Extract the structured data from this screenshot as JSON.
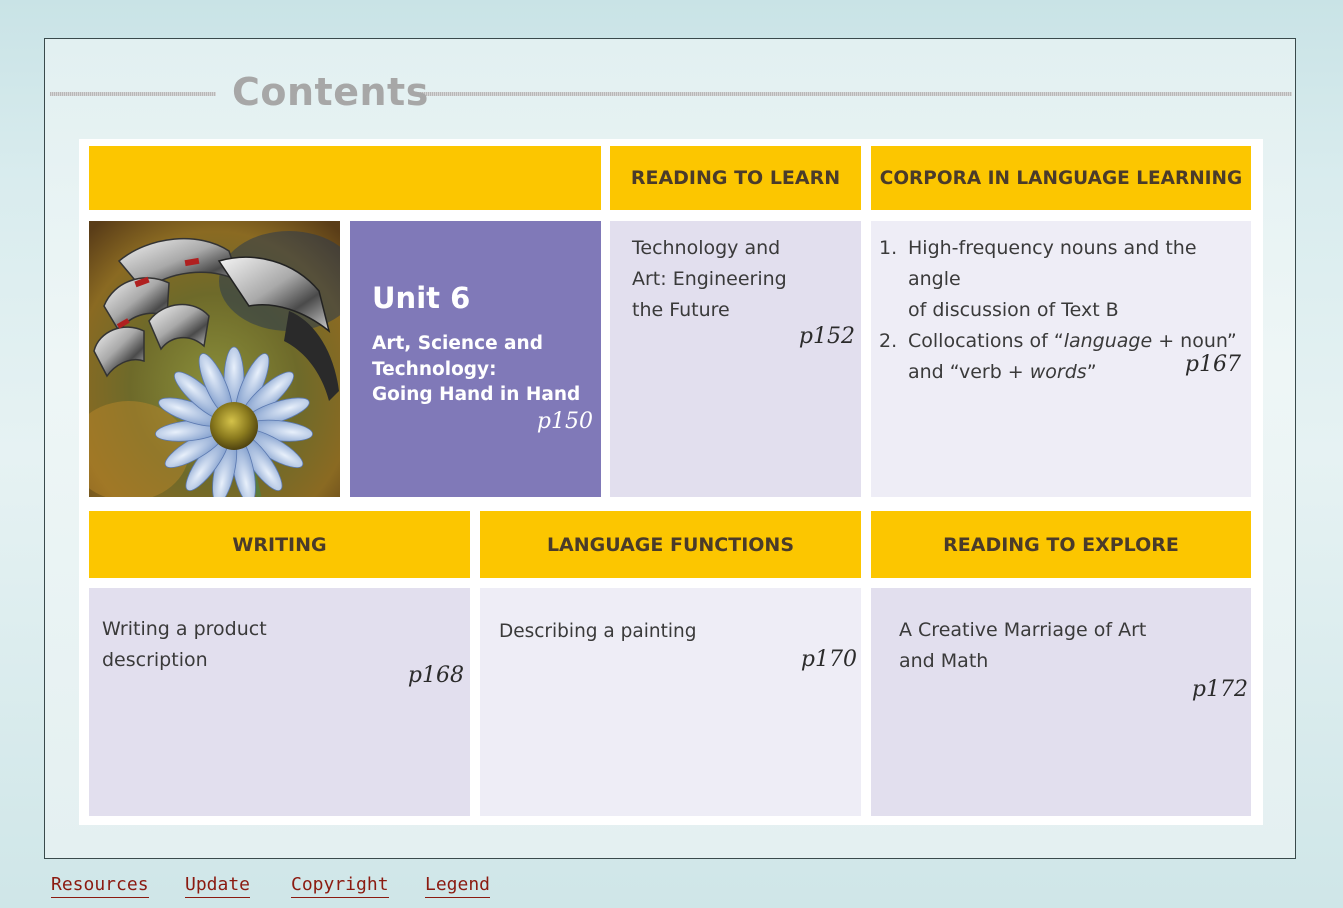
{
  "page": {
    "title": "Contents"
  },
  "unit": {
    "number": "Unit 6",
    "subtitle_line1": "Art, Science and",
    "subtitle_line2": "Technology:",
    "subtitle_line3": "Going Hand in Hand",
    "page_ref": "p150"
  },
  "reading_to_learn": {
    "header": "READING TO LEARN",
    "line1": "Technology and",
    "line2": "Art: Engineering",
    "line3": "the Future",
    "page_ref": "p152"
  },
  "corpora": {
    "header": "CORPORA IN LANGUAGE LEARNING",
    "item1_num": "1.",
    "item1_line1": "High-frequency nouns and the angle",
    "item1_line2": "of discussion of Text B",
    "item2_num": "2.",
    "item2_a": "Collocations of “",
    "item2_b": "language",
    "item2_c": " + noun”",
    "item2_line2_a": "and “verb + ",
    "item2_line2_b": "words",
    "item2_line2_c": "”",
    "page_ref": "p167"
  },
  "writing": {
    "header": "WRITING",
    "line1": "Writing a product",
    "line2": "description",
    "page_ref": "p168"
  },
  "language_functions": {
    "header": "LANGUAGE FUNCTIONS",
    "line1": "Describing a painting",
    "page_ref": "p170"
  },
  "reading_to_explore": {
    "header": "READING TO EXPLORE",
    "line1": "A Creative Marriage of Art",
    "line2": "and Math",
    "page_ref": "p172"
  },
  "footer": {
    "resources": "Resources",
    "update": "Update",
    "copyright": "Copyright",
    "legend": "Legend"
  },
  "colors": {
    "header_yellow": "#fcc600",
    "unit_purple": "#8079b8",
    "cell_lavender": "#e2dfee",
    "footer_link": "#8b1a10"
  },
  "image": {
    "icon": "robot-hand-holding-daisy-photo"
  }
}
